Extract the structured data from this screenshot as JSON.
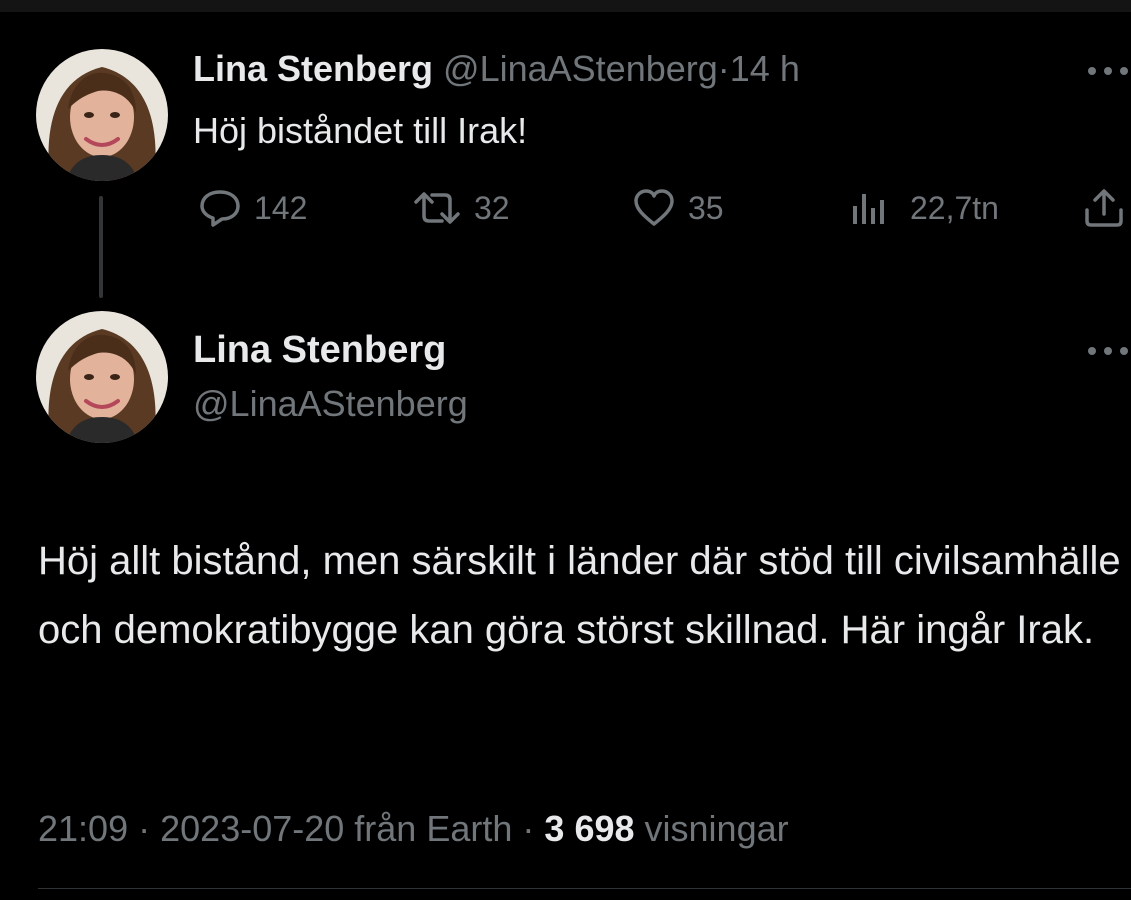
{
  "colors": {
    "background": "#000000",
    "text": "#e7e9ea",
    "muted": "#71767b",
    "divider": "#2f3336"
  },
  "reply_tweet": {
    "author_name": "Lina Stenberg",
    "author_handle": "@LinaAStenberg",
    "separator": "·",
    "time": "14 h",
    "text": "Höj biståndet till Irak!",
    "more_icon": "more-dots-icon",
    "actions": {
      "replies": "142",
      "retweets": "32",
      "likes": "35",
      "views": "22,7tn"
    },
    "icons": {
      "reply": "reply-bubble-icon",
      "retweet": "retweet-icon",
      "like": "heart-icon",
      "views": "views-bar-chart-icon",
      "share": "share-icon"
    }
  },
  "main_tweet": {
    "author_name": "Lina Stenberg",
    "author_handle": "@LinaAStenberg",
    "more_icon": "more-dots-icon",
    "text": "Höj allt bistånd, men särskilt i länder där stöd till civilsamhälle och demokratibygge kan göra störst skillnad. Här ingår Irak.",
    "meta": {
      "time": "21:09",
      "separator": "·",
      "date": "2023-07-20",
      "source": "från Earth",
      "views_count": "3 698",
      "views_label": "visningar"
    }
  }
}
